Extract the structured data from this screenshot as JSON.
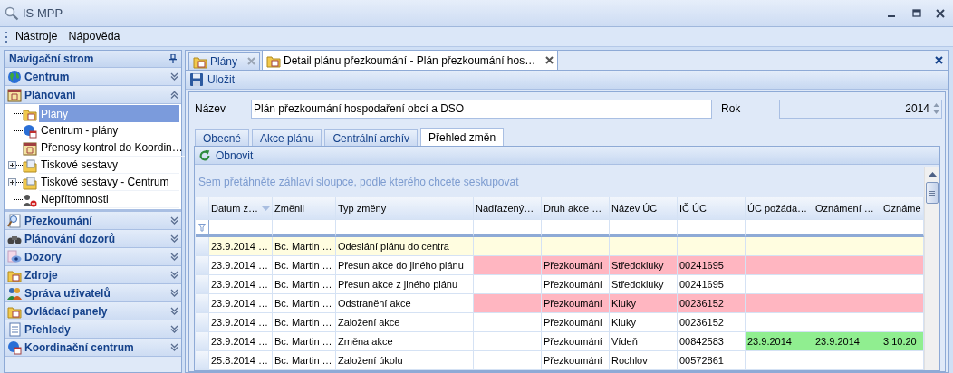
{
  "window": {
    "title": "IS MPP"
  },
  "menu": [
    "Nástroje",
    "Nápověda"
  ],
  "navigation": {
    "title": "Navigační strom",
    "groups": [
      {
        "label": "Centrum",
        "expanded": false
      },
      {
        "label": "Plánování",
        "expanded": true,
        "children": [
          {
            "label": "Plány",
            "selected": true,
            "expandable": false
          },
          {
            "label": "Centrum - plány",
            "selected": false,
            "expandable": false
          },
          {
            "label": "Přenosy kontrol do Koordin…",
            "selected": false,
            "expandable": false
          },
          {
            "label": "Tiskové sestavy",
            "selected": false,
            "expandable": true
          },
          {
            "label": "Tiskové sestavy - Centrum",
            "selected": false,
            "expandable": true
          },
          {
            "label": "Nepřítomnosti",
            "selected": false,
            "expandable": false
          }
        ]
      },
      {
        "label": "Přezkoumání",
        "expanded": false
      },
      {
        "label": "Plánování dozorů",
        "expanded": false
      },
      {
        "label": "Dozory",
        "expanded": false
      },
      {
        "label": "Zdroje",
        "expanded": false
      },
      {
        "label": "Správa uživatelů",
        "expanded": false
      },
      {
        "label": "Ovládací panely",
        "expanded": false
      },
      {
        "label": "Přehledy",
        "expanded": false
      },
      {
        "label": "Koordinační centrum",
        "expanded": false
      }
    ]
  },
  "document_tabs": [
    {
      "label": "Plány",
      "selected": false
    },
    {
      "label": "Detail plánu přezkoumání - Plán přezkoumání hos…",
      "selected": true
    }
  ],
  "toolbar": {
    "save": "Uložit"
  },
  "form": {
    "name_label": "Název",
    "name_value": "Plán přezkoumání hospodaření obcí a DSO",
    "year_label": "Rok",
    "year_value": "2014"
  },
  "tabs": [
    {
      "label": "Obecné",
      "selected": false
    },
    {
      "label": "Akce plánu",
      "selected": false
    },
    {
      "label": "Centrální archív",
      "selected": false
    },
    {
      "label": "Přehled změn",
      "selected": true
    }
  ],
  "grid_toolbar": {
    "refresh": "Obnovit"
  },
  "grid": {
    "group_hint": "Sem přetáhněte záhlaví sloupce, podle kterého chcete seskupovat",
    "columns": [
      {
        "label": "Datum z…",
        "sorted": true
      },
      {
        "label": "Změnil",
        "sorted": false
      },
      {
        "label": "Typ změny",
        "sorted": false
      },
      {
        "label": "Nadřazený…",
        "sorted": false
      },
      {
        "label": "Druh akce …",
        "sorted": false
      },
      {
        "label": "Název ÚC",
        "sorted": false
      },
      {
        "label": "IČ ÚC",
        "sorted": false
      },
      {
        "label": "ÚC požáda…",
        "sorted": false
      },
      {
        "label": "Oznámení …",
        "sorted": false
      },
      {
        "label": "Oznáme",
        "sorted": false
      }
    ],
    "rows": [
      {
        "kind": "sent",
        "cells": [
          "23.9.2014 …",
          "Bc. Martin …",
          "Odeslání plánu do centra",
          null,
          null,
          null,
          null,
          null,
          null,
          null
        ]
      },
      {
        "kind": "removed",
        "cells": [
          "23.9.2014 …",
          "Bc. Martin …",
          "Přesun akce do jiného plánu",
          null,
          "Přezkoumání",
          "Středokluky",
          "00241695",
          null,
          null,
          null
        ]
      },
      {
        "kind": "normal",
        "cells": [
          "23.9.2014 …",
          "Bc. Martin …",
          "Přesun akce z jiného plánu",
          null,
          "Přezkoumání",
          "Středokluky",
          "00241695",
          null,
          null,
          null
        ]
      },
      {
        "kind": "removed",
        "cells": [
          "23.9.2014 …",
          "Bc. Martin …",
          "Odstranění akce",
          null,
          "Přezkoumání",
          "Kluky",
          "00236152",
          null,
          null,
          null
        ]
      },
      {
        "kind": "normal",
        "cells": [
          "23.9.2014 …",
          "Bc. Martin …",
          "Založení akce",
          null,
          "Přezkoumání",
          "Kluky",
          "00236152",
          null,
          null,
          null
        ]
      },
      {
        "kind": "notified",
        "cells": [
          "23.9.2014 …",
          "Bc. Martin …",
          "Změna akce",
          null,
          "Přezkoumání",
          "Vídeň",
          "00842583",
          "23.9.2014",
          "23.9.2014",
          "3.10.20"
        ]
      },
      {
        "kind": "normal",
        "cells": [
          "25.8.2014 …",
          "Bc. Martin …",
          "Založení úkolu",
          null,
          "Přezkoumání",
          "Rochlov",
          "00572861",
          null,
          null,
          null
        ]
      }
    ]
  }
}
